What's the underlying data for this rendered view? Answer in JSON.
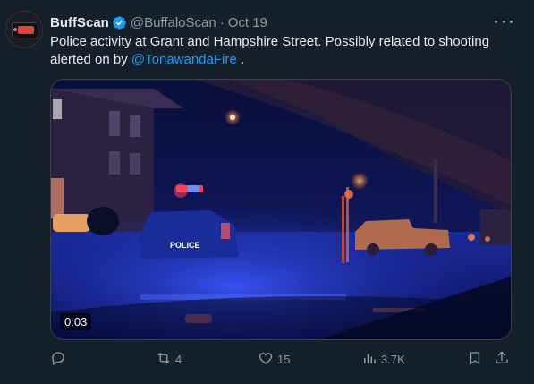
{
  "author": {
    "name": "BuffScan",
    "handle": "@BuffaloScan",
    "separator": "·",
    "date": "Oct 19"
  },
  "tweet": {
    "text_line1": "Police activity at Grant and Hampshire Street.  Possibly related to shooting",
    "text_line2_prefix": "alerted on by ",
    "mention": "@TonawandaFire",
    "text_line2_suffix": " ."
  },
  "media": {
    "duration": "0:03",
    "car_text": "POLICE"
  },
  "actions": {
    "reply_count": "",
    "retweet_count": "4",
    "like_count": "15",
    "views_count": "3.7K"
  },
  "icons": {
    "verified": "verified-badge-icon",
    "more": "more-icon",
    "reply": "reply-icon",
    "retweet": "retweet-icon",
    "like": "heart-icon",
    "views": "views-icon",
    "bookmark": "bookmark-icon",
    "share": "share-icon"
  },
  "colors": {
    "background": "#15202b",
    "accent": "#1d9bf0",
    "muted": "#8b98a5",
    "text": "#e7e9ea"
  }
}
